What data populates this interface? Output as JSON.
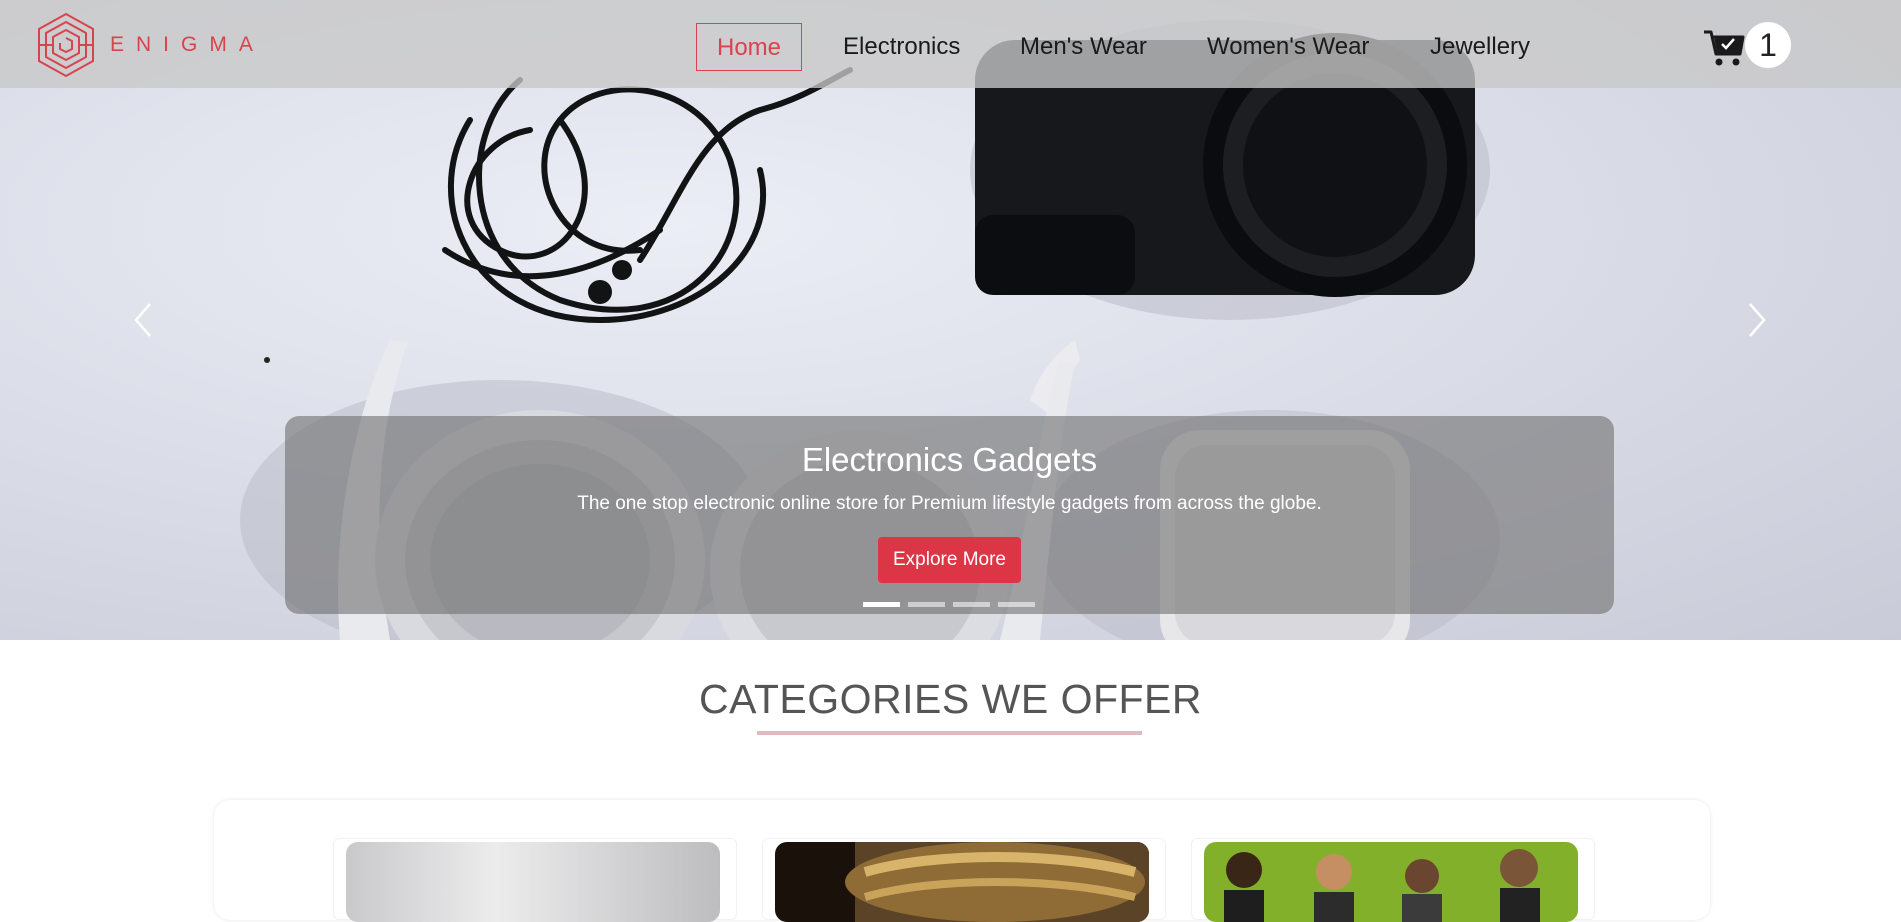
{
  "brand": {
    "name": "ENIGMA",
    "logo_icon": "hexagon-maze-logo-icon",
    "accent": "#d9434e"
  },
  "nav": {
    "items": [
      {
        "label": "Home",
        "active": true
      },
      {
        "label": "Electronics",
        "active": false
      },
      {
        "label": "Men's Wear",
        "active": false
      },
      {
        "label": "Women's Wear",
        "active": false
      },
      {
        "label": "Jewellery",
        "active": false
      }
    ]
  },
  "cart": {
    "icon": "shopping-cart-icon",
    "count": "1"
  },
  "carousel": {
    "slide": {
      "title": "Electronics Gadgets",
      "text": "The one stop electronic online store for Premium lifestyle gadgets from across the globe.",
      "button": "Explore More"
    },
    "slides_total": 4,
    "active_index": 0,
    "prev_icon": "chevron-left-icon",
    "next_icon": "chevron-right-icon",
    "button_color": "#dc3545"
  },
  "categories": {
    "title": "CATEGORIES WE OFFER",
    "cards": [
      {
        "name": "electronics",
        "image": "grey-gadget-photo"
      },
      {
        "name": "jewellery",
        "image": "gold-bangles-photo"
      },
      {
        "name": "mens-wear",
        "image": "people-on-green-background-photo"
      }
    ]
  }
}
